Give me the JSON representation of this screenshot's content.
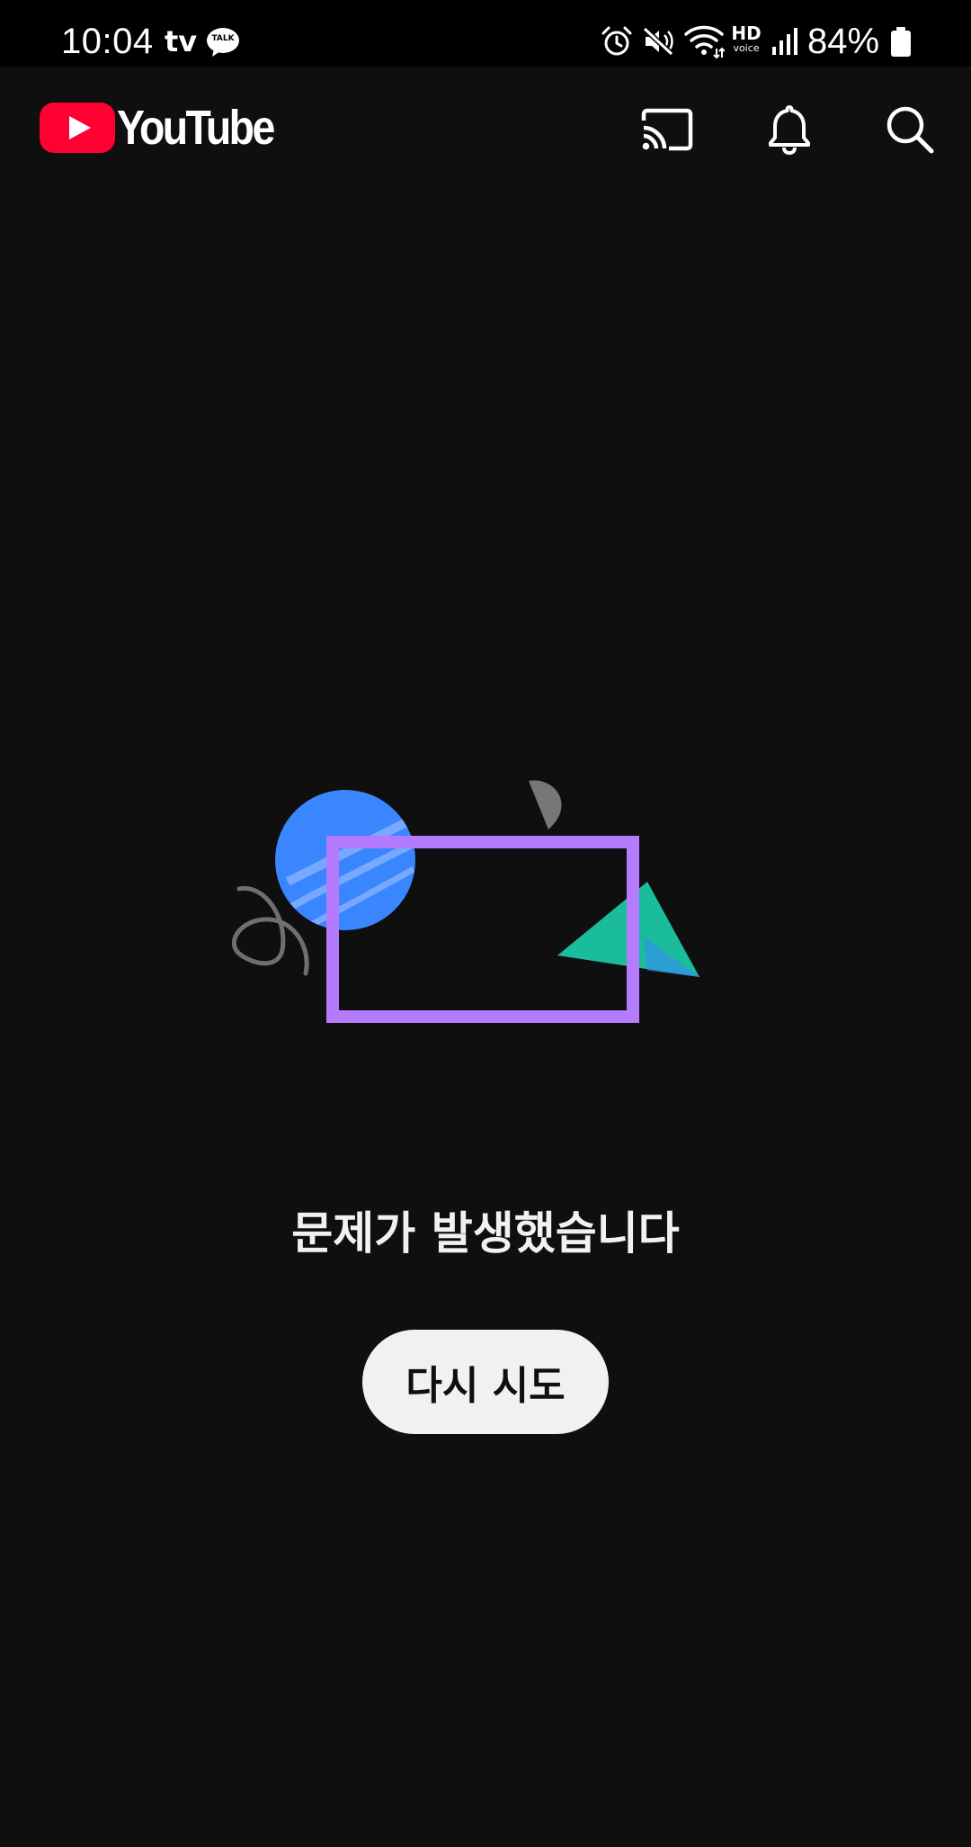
{
  "status_bar": {
    "time": "10:04",
    "tv_badge": "tv",
    "talk_badge": "TALK",
    "icons": [
      "alarm-icon",
      "mute-icon",
      "wifi-icon",
      "hd-voice-icon",
      "signal-icon",
      "battery-icon"
    ],
    "hd_top": "HD",
    "hd_bottom": "voice",
    "battery_percent": "84%"
  },
  "app_bar": {
    "logo_text": "YouTube",
    "logo_color": "#ff0033",
    "actions": [
      "cast-icon",
      "notifications-icon",
      "search-icon"
    ]
  },
  "error_state": {
    "illustration": "error-illustration",
    "message": "문제가 발생했습니다",
    "retry_label": "다시 시도"
  },
  "colors": {
    "background": "#0f0f0f",
    "status_bar": "#000000",
    "button_bg": "#f1f1f1",
    "button_text": "#0f0f0f",
    "illustration_blue": "#3a86ff",
    "illustration_purple": "#b57bff",
    "illustration_teal": "#1abc9c"
  }
}
